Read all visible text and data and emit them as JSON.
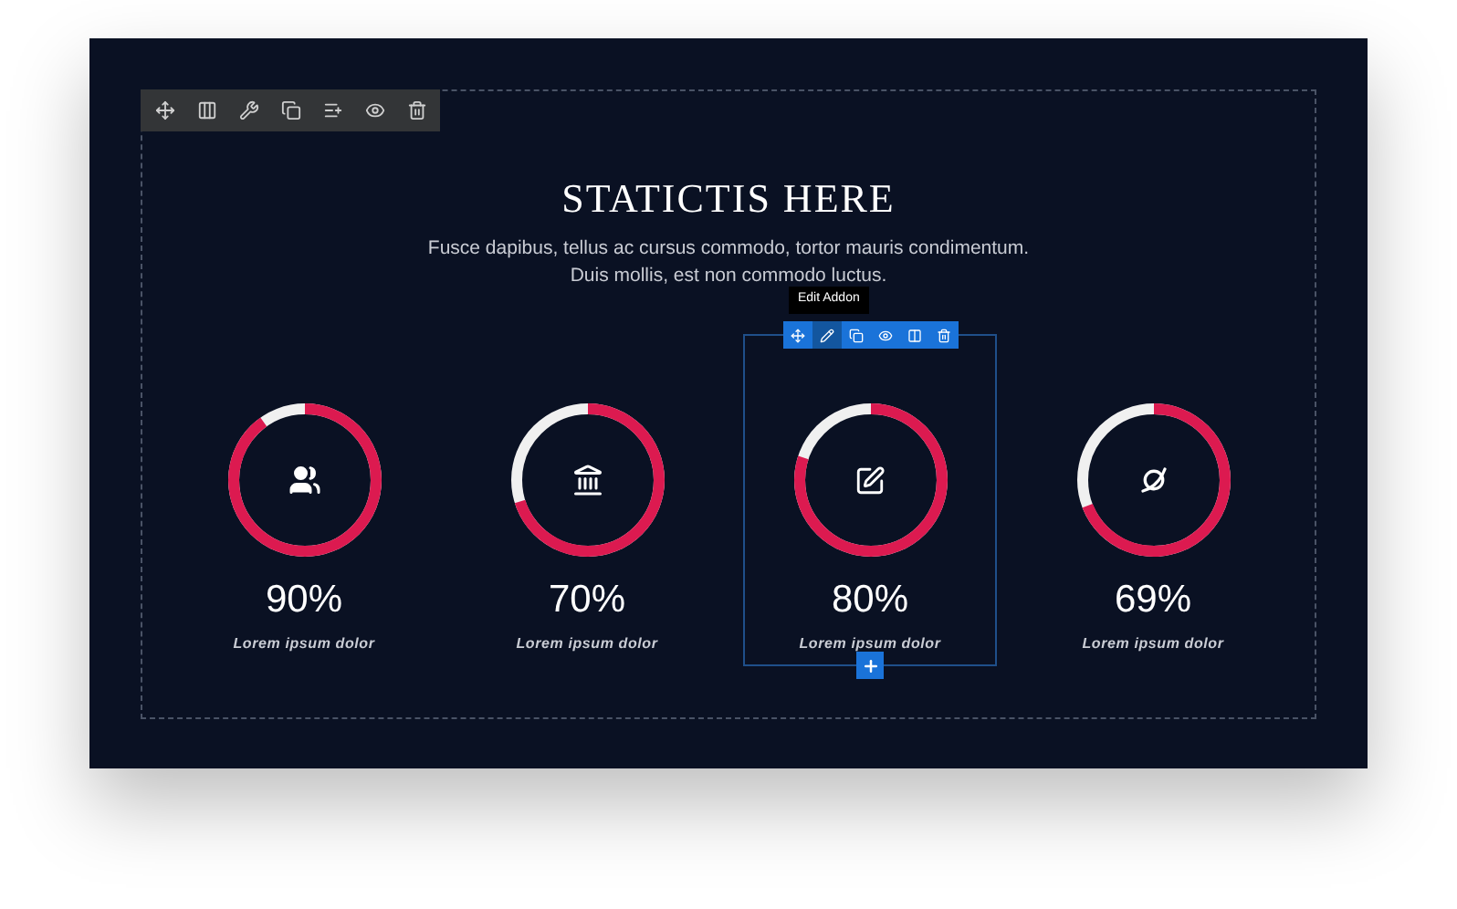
{
  "section": {
    "title": "STATICTIS HERE",
    "subtitle_lines": [
      "Fusce dapibus, tellus ac cursus commodo, tortor mauris condimentum.",
      "Duis mollis, est non commodo luctus."
    ]
  },
  "addon_toolbar": {
    "tooltip": "Edit Addon",
    "tools": [
      {
        "kind": "move",
        "selected": false
      },
      {
        "kind": "edit",
        "selected": true
      },
      {
        "kind": "copy",
        "selected": false
      },
      {
        "kind": "view",
        "selected": false
      },
      {
        "kind": "columns",
        "selected": false
      },
      {
        "kind": "delete",
        "selected": false
      }
    ]
  },
  "stats": [
    {
      "kind": "users",
      "value": "90%",
      "level": 0.9,
      "label": "Lorem ipsum dolor",
      "selected": false
    },
    {
      "kind": "bank",
      "value": "70%",
      "level": 0.7,
      "label": "Lorem ipsum dolor",
      "selected": false
    },
    {
      "kind": "edit",
      "value": "80%",
      "level": 0.8,
      "label": "Lorem ipsum dolor",
      "selected": true
    },
    {
      "kind": "orbit",
      "value": "69%",
      "level": 0.69,
      "label": "Lorem ipsum dolor",
      "selected": false
    }
  ]
}
